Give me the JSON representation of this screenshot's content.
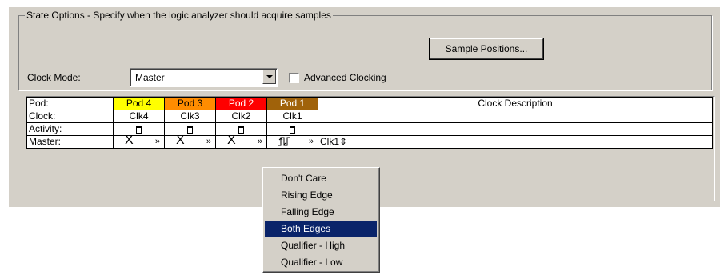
{
  "group": {
    "legend": "State Options - Specify when the logic analyzer should acquire samples"
  },
  "buttons": {
    "sample_positions": "Sample Positions..."
  },
  "clock_mode": {
    "label": "Clock Mode:",
    "value": "Master"
  },
  "advanced": {
    "label": "Advanced Clocking",
    "checked": false
  },
  "table": {
    "row_headers": [
      "Pod:",
      "Clock:",
      "Activity:",
      "Master:"
    ],
    "pods": [
      {
        "name": "Pod 4",
        "clock": "Clk4",
        "color": "#ffff00",
        "master": "X"
      },
      {
        "name": "Pod 3",
        "clock": "Clk3",
        "color": "#ff8c00",
        "master": "X"
      },
      {
        "name": "Pod 2",
        "clock": "Clk2",
        "color": "#ff0000",
        "master": "X"
      },
      {
        "name": "Pod 1",
        "clock": "Clk1",
        "color": "#a0620a",
        "master": "⮃"
      }
    ],
    "desc_header": "Clock Description",
    "desc_value": "Clk1⇕",
    "dropdown_glyph": "»"
  },
  "menu": {
    "items": [
      "Don't Care",
      "Rising Edge",
      "Falling Edge",
      "Both Edges",
      "Qualifier - High",
      "Qualifier - Low"
    ],
    "selected": "Both Edges",
    "selected_color": "#0a246a"
  }
}
